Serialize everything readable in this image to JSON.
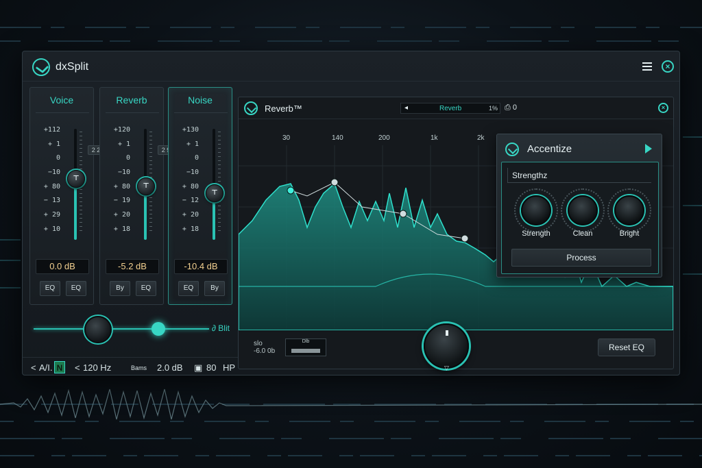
{
  "app": {
    "title": "dxSplit",
    "menu_icon": "hamburger-icon",
    "close_icon": "close-icon"
  },
  "strips": [
    {
      "name": "Voice",
      "scale": [
        "+112",
        "+ 1",
        "0",
        "−10",
        "+ 80",
        "− 13",
        "+ 29",
        "+ 10"
      ],
      "gain": "0.0 dB",
      "buttons": [
        "EQ",
        "EQ"
      ],
      "link_tag": "2 2",
      "fader_level": 0.55,
      "knob_symbol": "⊤"
    },
    {
      "name": "Reverb",
      "scale": [
        "+120",
        "+ 1",
        "0",
        "−10",
        "+ 80",
        "− 19",
        "+ 20",
        "+ 18"
      ],
      "gain": "-5.2 dB",
      "buttons": [
        "By",
        "EQ"
      ],
      "link_tag": "2 9",
      "fader_level": 0.48,
      "knob_symbol": "⊤"
    },
    {
      "name": "Noise",
      "scale": [
        "+130",
        "+ 1",
        "0",
        "−10",
        "+ 80",
        "− 12",
        "+ 20",
        "+ 18"
      ],
      "gain": "-10.4 dB",
      "buttons": [
        "EQ",
        "By"
      ],
      "link_tag": "",
      "fader_level": 0.42,
      "knob_symbol": "⊤"
    }
  ],
  "master": {
    "label": "Blit",
    "label_icon": "link-icon"
  },
  "status": {
    "mode": "A/I.",
    "badge": "N",
    "freq": "120 Hz",
    "param_label": "Bams",
    "param_value": "2.0 dB",
    "hp_value": "80",
    "hp_label": "HP"
  },
  "editor": {
    "title": "Reverb™",
    "preset_name": "Reverb",
    "preset_pct": "1%",
    "preset_count": "0",
    "freq_labels": [
      "30",
      "140",
      "200",
      "1k",
      "2k"
    ],
    "readout_top": "slo",
    "readout_bottom": "-6.0 0b",
    "mini_box_label": "Dlb",
    "reset_label": "Reset EQ",
    "accent_color": "#38d6c4"
  },
  "accentize": {
    "title": "Accentize",
    "param_label": "Strengthz",
    "knobs": [
      "Strength",
      "Clean",
      "Bright"
    ],
    "process_label": "Process"
  }
}
